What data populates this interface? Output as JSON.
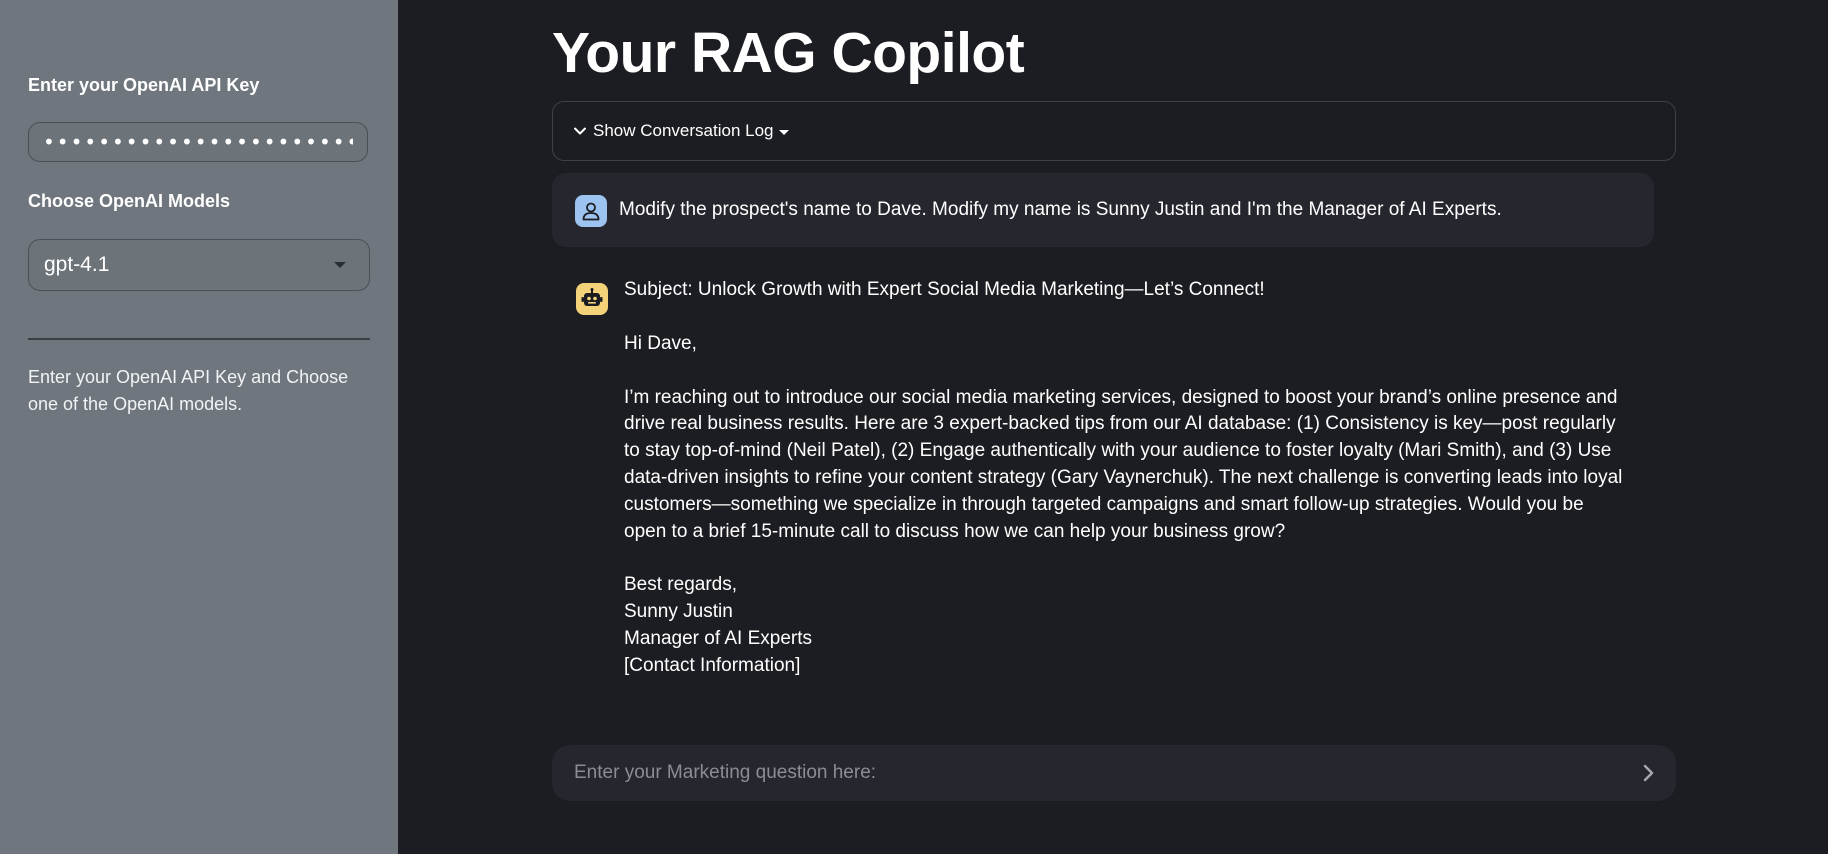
{
  "sidebar": {
    "api_key_label": "Enter your OpenAI API Key",
    "api_key_value": "•••••••••••••••••••••••••",
    "model_label": "Choose OpenAI Models",
    "model_selected": "gpt-4.1",
    "help_text": "Enter your OpenAI API Key and Choose one of the OpenAI models."
  },
  "main": {
    "title": "Your RAG Copilot",
    "expander_label": "Show Conversation Log",
    "user_message": "Modify the prospect's name to Dave. Modify my name is Sunny Justin and I'm the Manager of AI Experts.",
    "assistant_message": {
      "subject": "Subject: Unlock Growth with Expert Social Media Marketing—Let’s Connect!",
      "greeting": "Hi Dave,",
      "body": "I’m reaching out to introduce our social media marketing services, designed to boost your brand’s online presence and drive real business results. Here are 3 expert-backed tips from our AI database: (1) Consistency is key—post regularly to stay top-of-mind (Neil Patel), (2) Engage authentically with your audience to foster loyalty (Mari Smith), and (3) Use data-driven insights to refine your content strategy (Gary Vaynerchuk). The next challenge is converting leads into loyal customers—something we specialize in through targeted campaigns and smart follow-up strategies. Would you be open to a brief 15-minute call to discuss how we can help your business grow?",
      "closing": "Best regards,",
      "signature_name": "Sunny Justin",
      "signature_title": "Manager of AI Experts",
      "signature_contact": "[Contact Information]"
    },
    "chat_input_placeholder": "Enter your Marketing question here:"
  },
  "icons": {
    "user_avatar": "user-icon",
    "assistant_avatar": "robot-icon",
    "expander": "chevron-down-icon",
    "send": "chevron-right-icon",
    "select": "caret-down-icon"
  },
  "colors": {
    "sidebar_bg": "#6f767d",
    "main_bg": "#1c1d22",
    "user_avatar_bg": "#9dc3f0",
    "assistant_avatar_bg": "#f4d27a"
  }
}
